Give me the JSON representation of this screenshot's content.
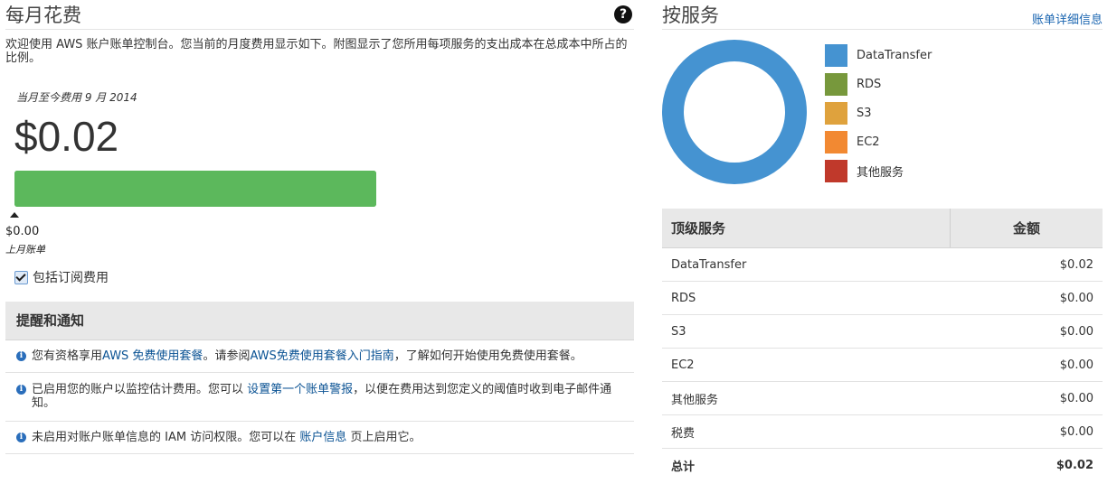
{
  "monthly": {
    "title": "每月花费",
    "help_glyph": "?",
    "intro": "欢迎使用 AWS 账户账单控制台。您当前的月度费用显示如下。附图显示了您所用每项服务的支出成本在总成本中所占的比例。",
    "mtd_label": "当月至今费用 9 月 2014",
    "amount": "$0.02",
    "bar_fill_fraction": 1.0,
    "bar_color": "#5cb85c",
    "prev_amount": "$0.00",
    "prev_label": "上月账单",
    "subscriptions_label": "包括订阅费用",
    "subscriptions_checked": true
  },
  "alerts": {
    "header": "提醒和通知",
    "items": [
      {
        "pre": "您有资格享用",
        "link1": "AWS 免费使用套餐",
        "mid": "。请参阅",
        "link2": "AWS免费使用套餐入门指南",
        "post": "，了解如何开始使用免费使用套餐。"
      },
      {
        "pre": "已启用您的账户以监控估计费用。您可以 ",
        "link1": "设置第一个账单警报",
        "post": "，以便在费用达到您定义的阈值时收到电子邮件通知。"
      },
      {
        "pre": "未启用对账户账单信息的 IAM 访问权限。您可以在 ",
        "link1": "账户信息",
        "post": " 页上启用它。"
      }
    ]
  },
  "by_service": {
    "title": "按服务",
    "detail_link": "账单详细信息",
    "legend": [
      {
        "label": "DataTransfer",
        "color": "#4593d1"
      },
      {
        "label": "RDS",
        "color": "#77983c"
      },
      {
        "label": "S3",
        "color": "#dfa23d"
      },
      {
        "label": "EC2",
        "color": "#f28932"
      },
      {
        "label": "其他服务",
        "color": "#c0392b"
      }
    ],
    "table": {
      "col_service": "顶级服务",
      "col_amount": "金额",
      "rows": [
        {
          "service": "DataTransfer",
          "amount": "$0.02"
        },
        {
          "service": "RDS",
          "amount": "$0.00"
        },
        {
          "service": "S3",
          "amount": "$0.00"
        },
        {
          "service": "EC2",
          "amount": "$0.00"
        },
        {
          "service": "其他服务",
          "amount": "$0.00"
        },
        {
          "service": "税费",
          "amount": "$0.00"
        }
      ],
      "total_label": "总计",
      "total_amount": "$0.02"
    }
  }
}
